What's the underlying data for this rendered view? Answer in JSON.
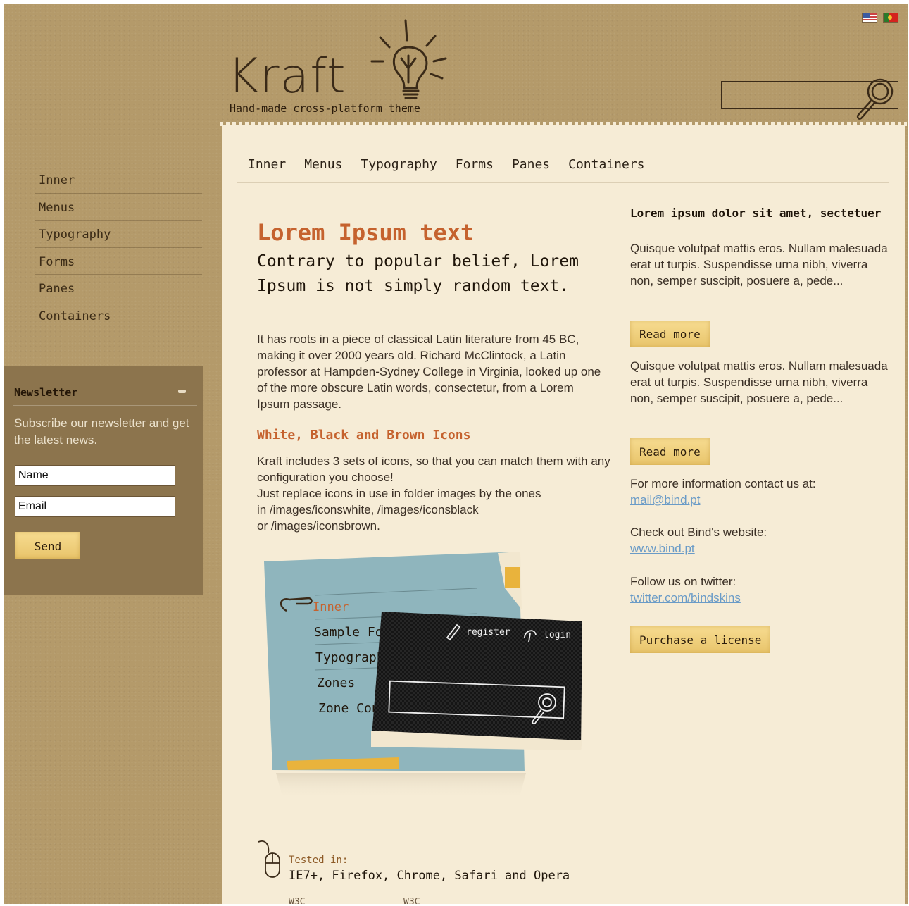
{
  "header": {
    "logo_text": "Kraft",
    "tagline": "Hand-made cross-platform theme",
    "search_value": "",
    "flags": [
      "English",
      "Português"
    ]
  },
  "top_nav": [
    "Inner",
    "Menus",
    "Typography",
    "Forms",
    "Panes",
    "Containers"
  ],
  "left_nav": [
    "Inner",
    "Menus",
    "Typography",
    "Forms",
    "Panes",
    "Containers"
  ],
  "newsletter": {
    "title": "Newsletter",
    "text": "Subscribe our newsletter and get the latest news.",
    "name_value": "Name",
    "email_value": "Email",
    "send_label": "Send"
  },
  "main": {
    "title": "Lorem Ipsum text",
    "subtitle": "Contrary to popular belief, Lorem Ipsum is not simply random text.",
    "paragraph1": "It has roots in a piece of classical Latin literature from 45 BC, making it over 2000 years old. Richard McClintock, a Latin professor at Hampden-Sydney College in Virginia, looked up one of the more obscure Latin words, consectetur, from a Lorem Ipsum passage.",
    "icons_heading": "White, Black and Brown Icons",
    "icons_line1": "Kraft includes 3 sets of icons, so that you can match them with any configuration you choose!",
    "icons_line2": "Just replace icons in use in folder images by the ones",
    "icons_line3": "in /images/iconswhite, /images/iconsblack",
    "icons_line4": "or /images/iconsbrown.",
    "tested_label": "Tested in:",
    "tested_browsers": "IE7+, Firefox, Chrome, Safari and Opera",
    "w3c_1": "W3C",
    "w3c_2": "W3C"
  },
  "preview": {
    "menu_items": [
      "Inner",
      "Sample Form",
      "Typography",
      "Zones",
      "Zone Containers"
    ],
    "register_label": "register",
    "login_label": "login"
  },
  "sidebar": {
    "title": "Lorem ipsum dolor sit amet, sectetuer",
    "paragraph1": "Quisque volutpat mattis eros. Nullam malesuada erat ut turpis. Suspendisse urna nibh, viverra non, semper suscipit, posuere a, pede...",
    "read_more_1": "Read more",
    "paragraph2": "Quisque volutpat mattis eros. Nullam malesuada erat ut turpis. Suspendisse urna nibh, viverra non, semper suscipit, posuere a, pede...",
    "read_more_2": "Read more",
    "contact_text": "For more information contact us at:",
    "contact_link": "mail@bind.pt",
    "website_text": "Check out Bind's website:",
    "website_link": "www.bind.pt",
    "twitter_text": "Follow us on twitter:",
    "twitter_link": "twitter.com/bindskins",
    "purchase_label": "Purchase a license"
  },
  "colors": {
    "background": "#b49a6a",
    "paper": "#f6ecd6",
    "accent": "#c5622e",
    "link": "#6a9bc7",
    "tape": "#f0cf7d"
  }
}
